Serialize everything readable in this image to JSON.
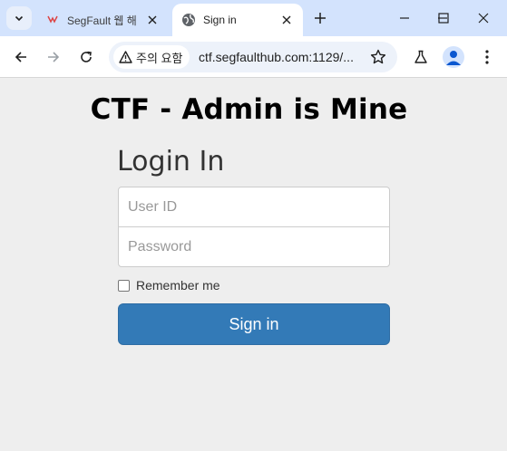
{
  "browser": {
    "tabs": [
      {
        "title": "SegFault 웹 해",
        "icon": "segfault-favicon",
        "active": false
      },
      {
        "title": "Sign in",
        "icon": "globe-icon",
        "active": true
      }
    ],
    "security_chip": "주의 요함",
    "url": "ctf.segfaulthub.com:1129/..."
  },
  "page": {
    "title": "CTF - Admin is Mine",
    "form_heading": "Login In",
    "user_id_placeholder": "User ID",
    "password_placeholder": "Password",
    "remember_label": "Remember me",
    "signin_label": "Sign in"
  },
  "colors": {
    "tabstrip": "#d3e3fd",
    "button": "#337ab7",
    "background": "#eeeeee"
  }
}
